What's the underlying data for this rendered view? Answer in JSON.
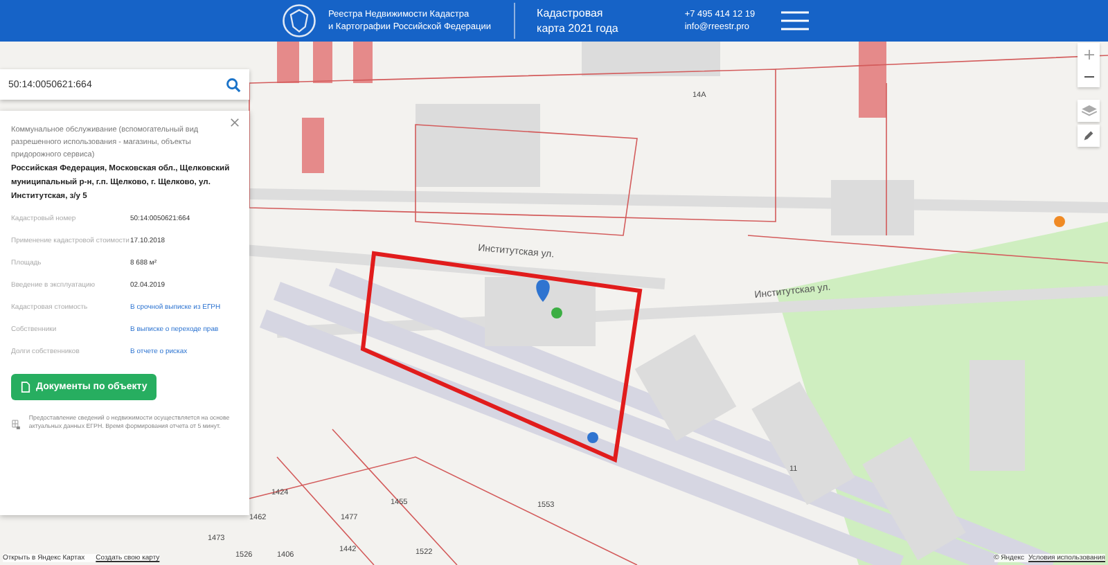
{
  "header": {
    "org_line_1": "Реестра Недвижимости Кадастра",
    "org_line_2": "и Картографии Российской Федерации",
    "map_line_1": "Кадастровая",
    "map_line_2": "карта 2021 года",
    "phone": "+7 495 414 12 19",
    "email": "info@rreestr.pro"
  },
  "search": {
    "value": "50:14:0050621:664"
  },
  "card": {
    "usage": "Коммунальное обслуживание (вспомогательный вид разрешенного использования - магазины, объекты придорожного сервиса)",
    "address": "Российская Федерация, Московская обл., Щелковский муниципальный р-н, г.п. Щелково, г. Щелково, ул. Институтская, з/у 5",
    "rows": [
      {
        "label": "Кадастровый номер",
        "value": "50:14:0050621:664",
        "kind": "text"
      },
      {
        "label": "Применение кадастровой стоимости",
        "value": "17.10.2018",
        "kind": "text"
      },
      {
        "label": "Площадь",
        "value": "8 688 м²",
        "kind": "text"
      },
      {
        "label": "Введение в эксплуатацию",
        "value": "02.04.2019",
        "kind": "text"
      },
      {
        "label": "Кадастровая стоимость",
        "value": "В срочной выписке из ЕГРН",
        "kind": "link"
      },
      {
        "label": "Собственники",
        "value": "В выписке о переходе прав",
        "kind": "link"
      },
      {
        "label": "Долги собственников",
        "value": "В отчете о рисках",
        "kind": "link"
      }
    ],
    "button": "Документы по объекту",
    "note": "Предоставление сведений о недвижимости осуществляется на основе актуальных данных ЕГРН. Время формирования отчета от 5 минут."
  },
  "map": {
    "streets": [
      "Институтская ул.",
      "Институтская ул."
    ],
    "parcels": [
      "1424",
      "1462",
      "1477",
      "1455",
      "1473",
      "1526",
      "1406",
      "1553",
      "1442",
      "1522",
      "14А",
      "11"
    ],
    "footer_links": [
      "Открыть в Яндекс Картах",
      "Создать свою карту"
    ],
    "copyright": "© Яндекс",
    "terms": "Условия использования"
  }
}
